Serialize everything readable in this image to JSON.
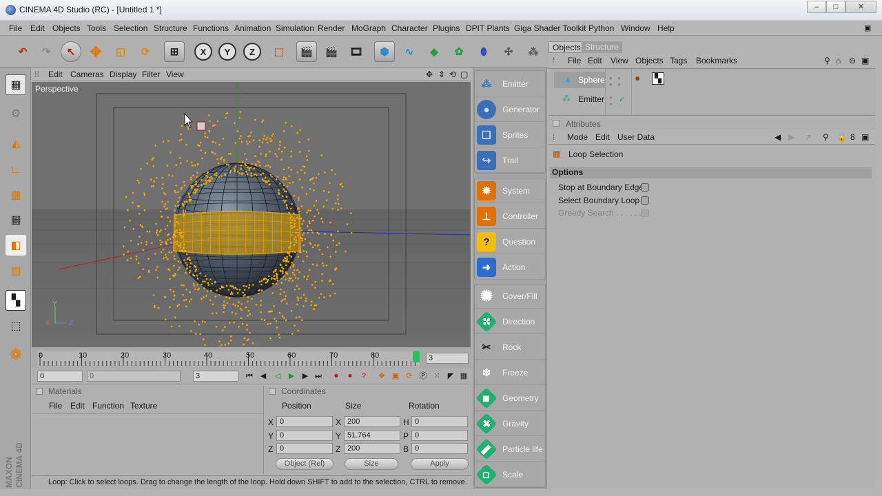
{
  "window": {
    "title": "CINEMA 4D Studio (RC) - [Untitled 1 *]",
    "buttons": [
      "–",
      "□",
      "✕"
    ]
  },
  "menubar": [
    "File",
    "Edit",
    "Objects",
    "Tools",
    "Selection",
    "Structure",
    "Functions",
    "Animation",
    "Simulation",
    "Render",
    "MoGraph",
    "Character",
    "Plugins",
    "DPIT Plants",
    "Giga Shader Toolkit",
    "Python",
    "Window",
    "Help"
  ],
  "toolbar": {
    "axis": [
      "X",
      "Y",
      "Z"
    ]
  },
  "viewport": {
    "menu": [
      "Edit",
      "Cameras",
      "Display",
      "Filter",
      "View"
    ],
    "label": "Perspective",
    "axis_labels": {
      "x": "X",
      "y": "Y",
      "z": "Z"
    }
  },
  "timeline": {
    "ticks": [
      "0",
      "10",
      "20",
      "30",
      "40",
      "50",
      "60",
      "70",
      "80"
    ],
    "current": "3"
  },
  "playbar": {
    "start": "0",
    "slider": "0",
    "end": "3"
  },
  "materials": {
    "title": "Materials",
    "menu": [
      "File",
      "Edit",
      "Function",
      "Texture"
    ]
  },
  "coordinates": {
    "title": "Coordinates",
    "headers": [
      "Position",
      "Size",
      "Rotation"
    ],
    "rows": [
      {
        "axis": "X",
        "pos": "0",
        "size_lbl": "X",
        "size": "200",
        "rot_lbl": "H",
        "rot": "0"
      },
      {
        "axis": "Y",
        "pos": "0",
        "size_lbl": "Y",
        "size": "51.764",
        "rot_lbl": "P",
        "rot": "0"
      },
      {
        "axis": "Z",
        "pos": "0",
        "size_lbl": "Z",
        "size": "200",
        "rot_lbl": "B",
        "rot": "0"
      }
    ],
    "mode": "Object (Rel)",
    "size_mode": "Size",
    "apply": "Apply"
  },
  "status": "Loop: Click to select loops. Drag to change the length of the loop. Hold down SHIFT to add to the selection, CTRL to remove.",
  "brand": {
    "maker": "MAXON",
    "product": "CINEMA 4D"
  },
  "palette": {
    "group1": [
      "Emitter",
      "Generator",
      "Sprites",
      "Trail"
    ],
    "group2": [
      "System",
      "Controller",
      "Question",
      "Action"
    ],
    "group3": [
      "Cover/Fill",
      "Direction",
      "Rock",
      "Freeze",
      "Geometry",
      "Gravity",
      "Particle life",
      "Scale"
    ]
  },
  "objects": {
    "tabs": [
      "Objects",
      "Structure"
    ],
    "menu": [
      "File",
      "Edit",
      "View",
      "Objects",
      "Tags",
      "Bookmarks"
    ],
    "items": [
      "Sphere",
      "Emitter"
    ]
  },
  "attributes": {
    "title": "Attributes",
    "menu": [
      "Mode",
      "Edit",
      "User Data"
    ],
    "tool": "Loop Selection",
    "section": "Options",
    "options": [
      "Stop at Boundary Edges",
      "Select Boundary Loop",
      "Greedy Search . . . . . . ."
    ]
  }
}
